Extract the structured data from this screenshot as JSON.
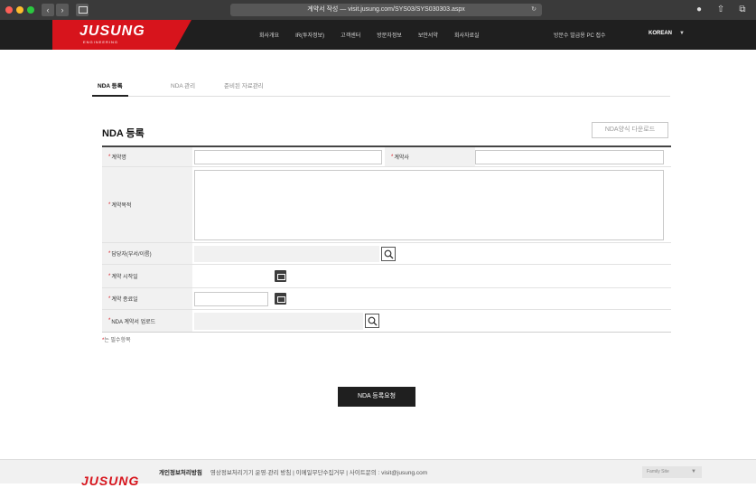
{
  "browser": {
    "url": "계약서 작성 — visit.jusung.com/SYS03/SYS030303.aspx",
    "reload_icon": "reload-icon",
    "nav_back": "‹",
    "nav_forward": "›"
  },
  "header": {
    "logo": "JUSUNG",
    "logo_sub": "ENGINEERING",
    "nav": [
      "회사개요",
      "IR(투자정보)",
      "고객센터",
      "방문자정보",
      "보안서약",
      "회사자료실"
    ],
    "extra": "방문수 발급용 PC 접수",
    "lang": "KOREAN",
    "lang_caret": "▼"
  },
  "tabs": [
    "NDA 등록",
    "NDA 관리",
    "준비된 자료관리"
  ],
  "page": {
    "title": "NDA 등록",
    "download_button": "NDA양식 다운로드"
  },
  "form": {
    "req_mark": "*",
    "contract_name_label": "계약명",
    "contractor_label": "계약사",
    "contract_purpose_label": "계약목적",
    "manager_label": "담당자(부서/이름)",
    "start_date_label": "계약 시작일",
    "end_date_label": "계약 종료일",
    "upload_label": "NDA 계약서 업로드"
  },
  "note": {
    "mark": "*",
    "text": "는 필수항목"
  },
  "submit_label": "NDA 등록요청",
  "footer": {
    "logo": "JUSUNG",
    "policy": "개인정보처리방침",
    "links": "영상정보처리기기 운영·관리 방침  |  이메일무단수집거부  |  사이트문의 : visit@jusung.com",
    "family_site": "Family Site",
    "family_caret": "▼"
  },
  "colors": {
    "brand_red": "#d7141c",
    "header_bg": "#1f1f1f",
    "label_bg": "#f1f1f1"
  }
}
